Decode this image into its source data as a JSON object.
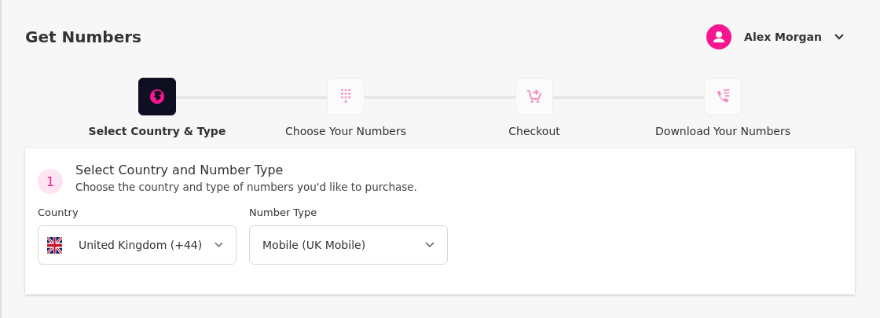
{
  "header": {
    "title": "Get Numbers",
    "user_name": "Alex Morgan"
  },
  "steps": [
    {
      "label": "Select Country & Type",
      "kind": "globe",
      "selected": true
    },
    {
      "label": "Choose Your Numbers",
      "kind": "dialpad",
      "selected": false
    },
    {
      "label": "Checkout",
      "kind": "cart",
      "selected": false
    },
    {
      "label": "Download Your Numbers",
      "kind": "phone-list",
      "selected": false
    }
  ],
  "section": {
    "number": "1",
    "title": "Select Country and Number Type",
    "description": "Choose the country and type of numbers you'd like to purchase.",
    "fields": [
      {
        "label": "Country",
        "value": "United Kingdom (+44)",
        "kind": "flag"
      },
      {
        "label": "Number Type",
        "value": "Mobile (UK Mobile)",
        "kind": "plain"
      }
    ]
  }
}
